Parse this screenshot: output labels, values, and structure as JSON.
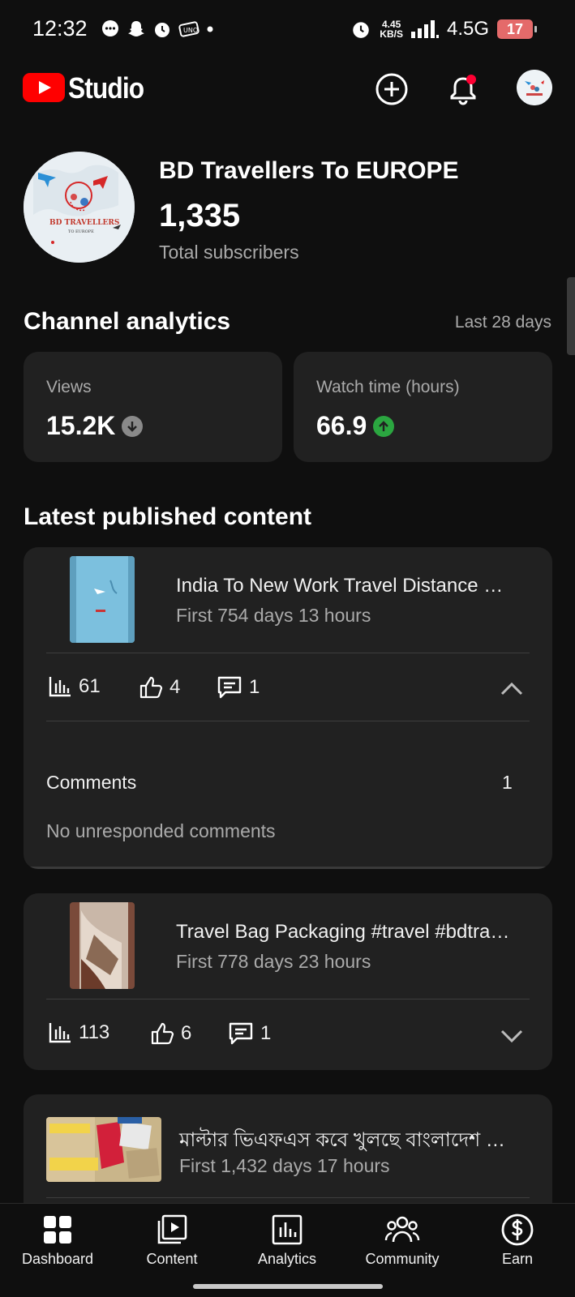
{
  "status_bar": {
    "time": "12:32",
    "speed_value": "4.45",
    "speed_unit": "KB/S",
    "network": "4.5G",
    "battery": "17"
  },
  "app_bar": {
    "title": "Studio",
    "brand_color": "#ff0000",
    "create_icon": "add-circle-icon",
    "notifications_icon": "bell-icon"
  },
  "channel": {
    "name": "BD Travellers To EUROPE",
    "subscribers": "1,335",
    "subscribers_label": "Total subscribers",
    "avatar_text_line1": "BD TRAVELLERS",
    "avatar_text_line2": "TO EUROPE"
  },
  "analytics": {
    "title": "Channel analytics",
    "period": "Last 28 days",
    "metrics": [
      {
        "label": "Views",
        "value": "15.2K",
        "trend": "down",
        "trend_color": "#8a8a8a"
      },
      {
        "label": "Watch time (hours)",
        "value": "66.9",
        "trend": "up",
        "trend_color": "#2ba640"
      }
    ]
  },
  "latest": {
    "title": "Latest published content",
    "items": [
      {
        "title": "India To New Work Travel Distance …",
        "subtitle": "First 754 days 13 hours",
        "views": "61",
        "likes": "4",
        "comments": "1",
        "expanded": true,
        "details": {
          "comments_label": "Comments",
          "comments_count": "1",
          "unresponded": "No unresponded comments"
        }
      },
      {
        "title": "Travel Bag Packaging #travel #bdtra…",
        "subtitle": "First 778 days 23 hours",
        "views": "113",
        "likes": "6",
        "comments": "1",
        "expanded": false
      },
      {
        "title": "মাল্টার ভিএফএস কবে খুলছে বাংলাদেশ …",
        "subtitle": "First 1,432 days 17 hours"
      }
    ]
  },
  "bottom_nav": [
    {
      "label": "Dashboard",
      "icon": "dashboard-icon"
    },
    {
      "label": "Content",
      "icon": "content-icon"
    },
    {
      "label": "Analytics",
      "icon": "analytics-icon"
    },
    {
      "label": "Community",
      "icon": "community-icon"
    },
    {
      "label": "Earn",
      "icon": "earn-icon"
    }
  ]
}
